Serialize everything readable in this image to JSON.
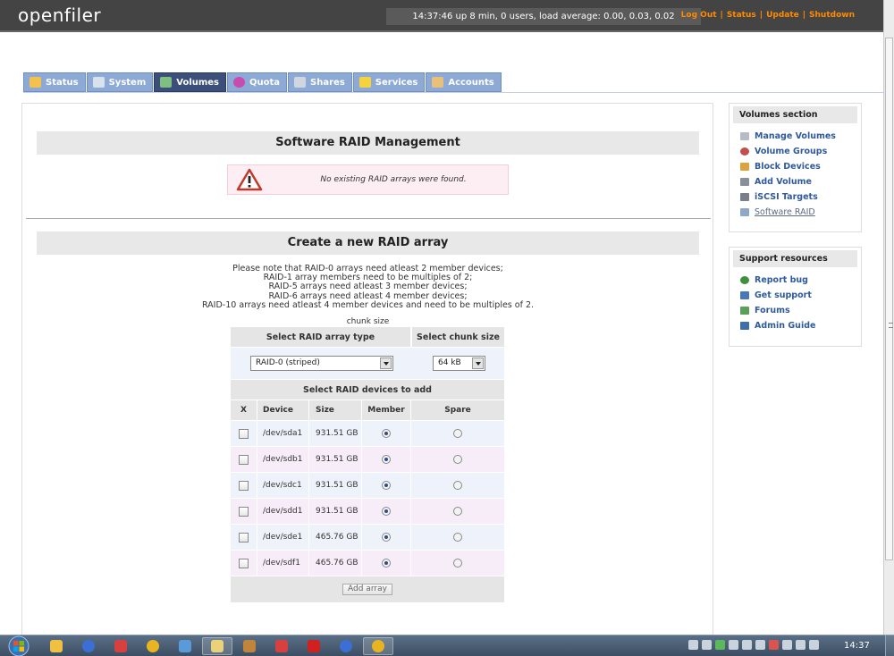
{
  "header": {
    "logo": "openfiler",
    "uptime": "14:37:46 up 8 min, 0 users, load average: 0.00, 0.03, 0.02",
    "links": [
      {
        "label": "Log Out"
      },
      {
        "label": "Status"
      },
      {
        "label": "Update"
      },
      {
        "label": "Shutdown"
      }
    ]
  },
  "tabs": [
    {
      "label": "Status",
      "icon": "status-icon",
      "color": "#f2c14e"
    },
    {
      "label": "System",
      "icon": "system-icon",
      "color": "#d8e1ee"
    },
    {
      "label": "Volumes",
      "icon": "volumes-icon",
      "color": "#7fbf7f",
      "active": true
    },
    {
      "label": "Quota",
      "icon": "quota-icon",
      "color": "#c84bb0"
    },
    {
      "label": "Shares",
      "icon": "shares-icon",
      "color": "#cfd6df"
    },
    {
      "label": "Services",
      "icon": "services-icon",
      "color": "#f5d33d"
    },
    {
      "label": "Accounts",
      "icon": "accounts-icon",
      "color": "#e8c07a"
    }
  ],
  "main": {
    "raid_title": "Software RAID Management",
    "notice": "No existing RAID arrays were found.",
    "create_title": "Create a new RAID array",
    "notes": [
      "Please note that RAID-0 arrays need atleast 2 member devices;",
      "RAID-1 array members need to be multiples of 2;",
      "RAID-5 arrays need atleast 3 member devices;",
      "RAID-6 arrays need atleast 4 member devices;",
      "RAID-10 arrays need atleast 4 member devices and need to be multiples of 2."
    ],
    "chunk_label": "chunk size",
    "form": {
      "type_header": "Select RAID array type",
      "chunk_header": "Select chunk size",
      "type_value": "RAID-0 (striped)",
      "chunk_value": "64 kB",
      "devices_header": "Select RAID devices to add",
      "columns": {
        "x": "X",
        "device": "Device",
        "size": "Size",
        "member": "Member",
        "spare": "Spare"
      },
      "devices": [
        {
          "device": "/dev/sda1",
          "size": "931.51 GB"
        },
        {
          "device": "/dev/sdb1",
          "size": "931.51 GB"
        },
        {
          "device": "/dev/sdc1",
          "size": "931.51 GB"
        },
        {
          "device": "/dev/sdd1",
          "size": "931.51 GB"
        },
        {
          "device": "/dev/sde1",
          "size": "465.76 GB"
        },
        {
          "device": "/dev/sdf1",
          "size": "465.76 GB"
        }
      ],
      "submit_label": "Add array"
    }
  },
  "sidebar": {
    "volumes_title": "Volumes section",
    "volumes_items": [
      {
        "label": "Manage Volumes",
        "icon": "manage-volumes-icon",
        "color": "#b7bcc4"
      },
      {
        "label": "Volume Groups",
        "icon": "volume-groups-icon",
        "color": "#c0504d"
      },
      {
        "label": "Block Devices",
        "icon": "block-devices-icon",
        "color": "#d9a441"
      },
      {
        "label": "Add Volume",
        "icon": "add-volume-icon",
        "color": "#8a9099"
      },
      {
        "label": "iSCSI Targets",
        "icon": "iscsi-targets-icon",
        "color": "#7a8088"
      },
      {
        "label": "Software RAID",
        "icon": "software-raid-icon",
        "color": "#8fa8c8"
      }
    ],
    "support_title": "Support resources",
    "support_items": [
      {
        "label": "Report bug",
        "icon": "report-bug-icon",
        "color": "#3f8f3f"
      },
      {
        "label": "Get support",
        "icon": "get-support-icon",
        "color": "#4a78b5"
      },
      {
        "label": "Forums",
        "icon": "forums-icon",
        "color": "#5aa05a"
      },
      {
        "label": "Admin Guide",
        "icon": "admin-guide-icon",
        "color": "#3f6ea8"
      }
    ]
  },
  "taskbar": {
    "clock": "14:37",
    "items": [
      {
        "name": "file-manager-icon",
        "color": "#f0c040"
      },
      {
        "name": "remote-app-icon",
        "color": "#3b6fd6"
      },
      {
        "name": "mail-app-icon",
        "color": "#d84040"
      },
      {
        "name": "chrome-icon",
        "color": "#e8b420"
      },
      {
        "name": "network-app-icon",
        "color": "#5a9ad8"
      },
      {
        "name": "folder-icon",
        "color": "#e9d27a",
        "active": true
      },
      {
        "name": "user-app-icon",
        "color": "#c0843a"
      },
      {
        "name": "mail-app-2-icon",
        "color": "#d84040"
      },
      {
        "name": "pdf-icon",
        "color": "#d02020"
      },
      {
        "name": "remote-app-2-icon",
        "color": "#3b6fd6"
      },
      {
        "name": "chrome-2-icon",
        "color": "#e8b420"
      }
    ]
  }
}
